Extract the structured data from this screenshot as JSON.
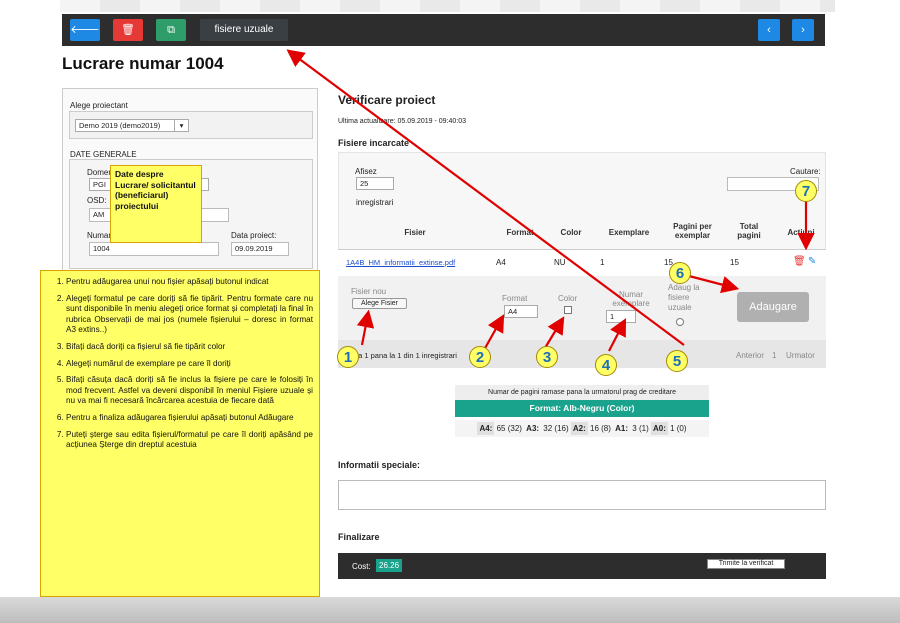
{
  "toolbar": {
    "back_icon": "arrow-left-icon",
    "delete_icon": "trash-icon",
    "copy_icon": "copy-icon",
    "tab_label": "fisiere uzuale",
    "prev_icon": "chevron-left-icon",
    "next_icon": "chevron-right-icon",
    "back_glyph": "🡐",
    "delete_glyph": "🗑",
    "copy_glyph": "⧉",
    "prev_glyph": "‹",
    "next_glyph": "›"
  },
  "page_title": "Lucrare numar 1004",
  "left": {
    "designer_label": "Alege proiectant",
    "designer_value": "Demo 2019 (demo2019)",
    "general_section": "DATE GENERALE",
    "domain_label": "Domen",
    "domain_value": "PGI",
    "osd_label": "OSD:",
    "osd_value": "AM",
    "number_label": "Numar",
    "number_value": "1004",
    "date_label": "Data proiect:",
    "date_value": "09.09.2019"
  },
  "callout_top": "Date despre Lucrare/ solicitantul (beneficiarul) proiectului",
  "steps": [
    "Pentru adăugarea unui nou fișier apăsați butonul indicat",
    "Alegeți formatul pe care doriți să fie tipărit. Pentru formate care nu sunt disponibile în meniu alegeți orice format și completați la final în rubrica Observații de mai jos (numele fișierului – doresc in format A3 extins..)",
    "Bifați dacă doriți ca fișierul să fie tipărit color",
    "Alegeți numărul de exemplare pe care îl doriți",
    "Bifați căsuța dacă doriți să fie inclus la fișiere pe care le folosiți în mod frecvent. Astfel va deveni disponibil în meniul Fișiere uzuale și nu va mai fi necesară încărcarea acestuia de fiecare dată",
    "Pentru a finaliza adăugarea fișierului apăsați butonul Adăugare",
    "Puteți șterge sau edita fișierul/formatul pe care îl doriți apăsând pe acțiunea Șterge din dreptul acestuia"
  ],
  "verify": {
    "title": "Verificare proiect",
    "last_update": "Ultima actualizare: 05.09.2019 - 09:40:03",
    "files_heading": "Fisiere incarcate",
    "show_label": "Afisez",
    "show_value": "25",
    "records_label": "inregistrari",
    "search_label": "Cautare:",
    "columns": [
      "Fisier",
      "Format",
      "Color",
      "Exemplare",
      "Pagini per exemplar",
      "Total pagini",
      "Actiuni"
    ],
    "row": {
      "file": "1A4B_HM_informatii_extinse.pdf",
      "format": "A4",
      "color": "NU",
      "copies": "1",
      "pages": "15",
      "total": "15"
    },
    "new_file_label": "Fisier nou",
    "choose_file_button": "Alege Fisier",
    "format_label": "Format",
    "format_value": "A4",
    "color_label": "Color",
    "copies_label": "Numar exemplare",
    "copies_value": "1",
    "add_usual_label": "Adaug la fisiere uzuale",
    "add_button": "Adaugare",
    "pager_info": "de la 1 pana la 1 din 1 inregistrari",
    "prev": "Anterior",
    "page": "1",
    "next": "Urmator"
  },
  "credit": {
    "caption": "Numar de pagini ramase pana la urmatorul prag de creditare",
    "format_header": "Format: Alb-Negru (Color)",
    "items": [
      {
        "label": "A4:",
        "value": "65 (32)"
      },
      {
        "label": "A3:",
        "value": "32 (16)"
      },
      {
        "label": "A2:",
        "value": "16 (8)"
      },
      {
        "label": "A1:",
        "value": "3 (1)"
      },
      {
        "label": "A0:",
        "value": "1 (0)"
      }
    ]
  },
  "special_info_label": "Informatii speciale:",
  "finalize": {
    "title": "Finalizare",
    "cost_label": "Cost:",
    "cost_value": "26.26",
    "submit_button": "Trimite la verificat"
  },
  "markers": [
    "1",
    "2",
    "3",
    "4",
    "5",
    "6",
    "7"
  ],
  "colors": {
    "toolbar_bg": "#2d2d2d",
    "accent_blue": "#1e88e5",
    "danger_red": "#e53935",
    "success_green": "#2e9d6a",
    "teal": "#1aa38c",
    "callout_yellow": "#ffff66",
    "arrow_red": "#e00000"
  }
}
